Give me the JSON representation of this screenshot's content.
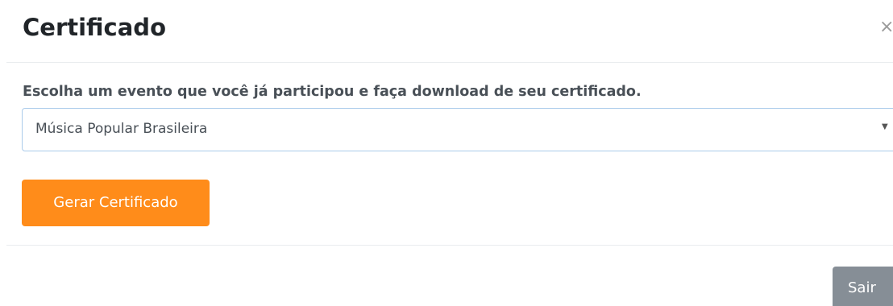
{
  "modal": {
    "title": "Certificado",
    "close_label": "×",
    "prompt": "Escolha um evento que você já participou e faça download de seu certificado.",
    "event_select": {
      "selected": "Música Popular Brasileira",
      "arrow": "▼"
    },
    "generate_button_label": "Gerar Certificado",
    "exit_button_label": "Sair"
  },
  "colors": {
    "accent": "#ff8c1a",
    "secondary_button": "#868e96",
    "select_border": "#aacbea"
  },
  "icons": {
    "close": "close-icon",
    "dropdown": "chevron-down-icon"
  }
}
